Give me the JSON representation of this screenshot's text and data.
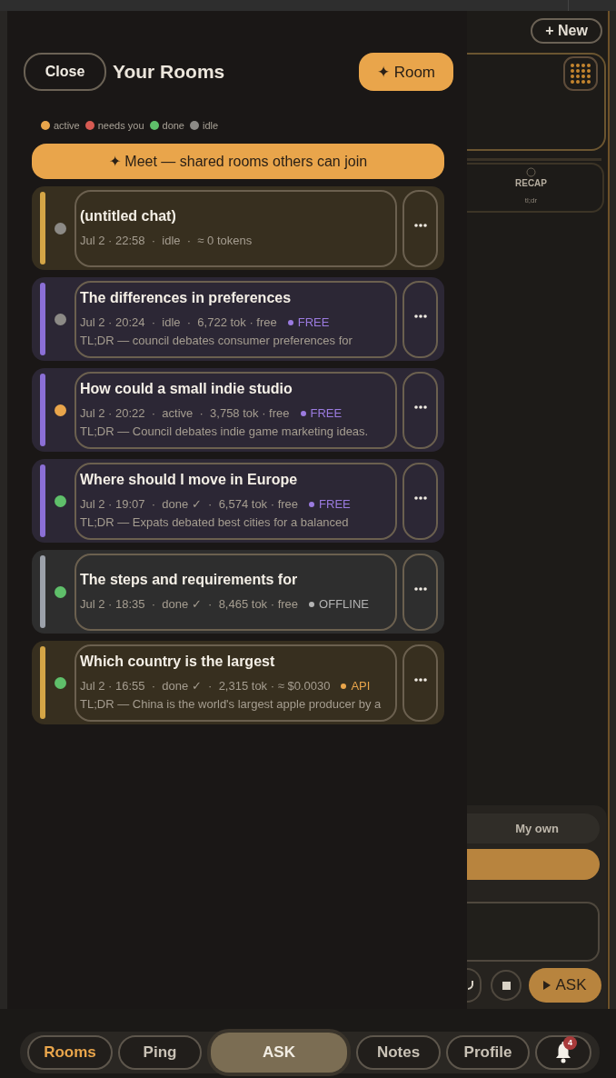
{
  "drawer": {
    "close_button": "Close",
    "title": "Your Rooms",
    "new_room_button": "✦ Room",
    "legend": [
      {
        "label": "active",
        "color": "#e9a54b"
      },
      {
        "label": "needs you",
        "color": "#d65a52"
      },
      {
        "label": "done",
        "color": "#5fbf6a"
      },
      {
        "label": "idle",
        "color": "#8c8a86"
      }
    ],
    "meet_button": "✦ Meet — shared rooms others can join",
    "rooms": [
      {
        "title": "(untitled chat)",
        "meta": "Jul 2 · 22:58  ·  idle  ·  ≈ 0 tokens",
        "color": "#d4a546",
        "status_dot": {
          "color": "#8c8a86"
        }
      },
      {
        "title": "The differences in preferences",
        "meta": "Jul 2 · 20:24  ·  idle  ·  6,722 tok · free",
        "tier": {
          "label": "FREE",
          "color": "#9b7be0"
        },
        "tldr": "TL;DR — council debates consumer preferences for",
        "color": "#8b6fd6",
        "status_dot": {
          "color": "#8c8a86"
        }
      },
      {
        "title": "How could a small indie studio",
        "meta": "Jul 2 · 20:22  ·  active  ·  3,758 tok · free",
        "tier": {
          "label": "FREE",
          "color": "#9b7be0"
        },
        "tldr": "TL;DR — Council debates indie game marketing ideas.",
        "color": "#8b6fd6",
        "status_dot": {
          "color": "#e9a54b"
        }
      },
      {
        "title": "Where should I move in Europe",
        "meta": "Jul 2 · 19:07  ·  done ✓  ·  6,574 tok · free",
        "tier": {
          "label": "FREE",
          "color": "#9b7be0"
        },
        "tldr": "TL;DR — Expats debated best cities for a balanced",
        "color": "#8b6fd6",
        "status_dot": {
          "color": "#5fbf6a"
        }
      },
      {
        "title": "The steps and requirements for",
        "meta": "Jul 2 · 18:35  ·  done ✓  ·  8,465 tok · free",
        "tier": {
          "label": "OFFLINE",
          "color": "#b4b4b4"
        },
        "color": "#9ca1aa",
        "status_dot": {
          "color": "#5fbf6a"
        }
      },
      {
        "title": "Which country is the largest",
        "meta": "Jul 2 · 16:55  ·  done ✓  ·  2,315 tok · ≈ $0.0030",
        "tier": {
          "label": "API",
          "color": "#e9a54b"
        },
        "tldr": "TL;DR — China is the world's largest apple producer by a",
        "color": "#d4a546",
        "status_dot": {
          "color": "#5fbf6a"
        }
      }
    ]
  },
  "side_panel": {
    "new_button": "+ New",
    "recap_card": {
      "title": "RECAP",
      "subtitle": "tl;dr"
    },
    "mode_option": "My own",
    "ask_button": "ASK"
  },
  "bottom_nav": [
    {
      "kind": "tab",
      "label": "Rooms",
      "selected": true
    },
    {
      "kind": "tab",
      "label": "Ping",
      "selected": false
    },
    {
      "kind": "primary",
      "label": "ASK",
      "selected": false
    },
    {
      "kind": "tab",
      "label": "Notes",
      "selected": false
    },
    {
      "kind": "tab",
      "label": "Profile",
      "selected": false
    },
    {
      "kind": "bell",
      "badge": "4",
      "selected": false
    }
  ]
}
